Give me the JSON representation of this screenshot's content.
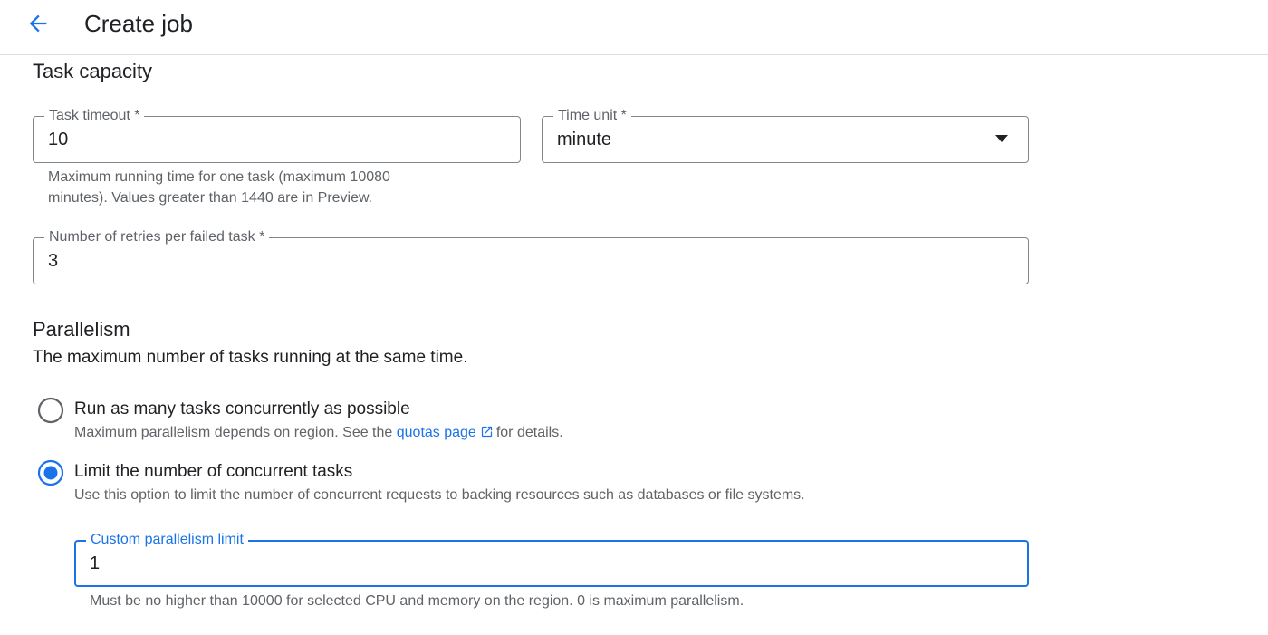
{
  "header": {
    "title": "Create job"
  },
  "task_capacity": {
    "title": "Task capacity",
    "task_timeout": {
      "label": "Task timeout *",
      "value": "10",
      "hint_line1": "Maximum running time for one task (maximum 10080",
      "hint_line2": "minutes). Values greater than 1440 are in Preview."
    },
    "time_unit": {
      "label": "Time unit *",
      "value": "minute"
    },
    "retries": {
      "label": "Number of retries per failed task *",
      "value": "3"
    }
  },
  "parallelism": {
    "title": "Parallelism",
    "description": "The maximum number of tasks running at the same time.",
    "option_unlimited": {
      "label": "Run as many tasks concurrently as possible",
      "desc_before": "Maximum parallelism depends on region. See the ",
      "link": "quotas page",
      "desc_after": "for details.",
      "selected": false
    },
    "option_limit": {
      "label": "Limit the number of concurrent tasks",
      "desc": "Use this option to limit the number of concurrent requests to backing resources such as databases or file systems.",
      "selected": true
    },
    "custom_limit": {
      "label": "Custom parallelism limit",
      "value": "1",
      "hint": "Must be no higher than 10000 for selected CPU and memory on the region. 0 is maximum parallelism."
    }
  },
  "colors": {
    "accent": "#1a73e8",
    "text": "#202124",
    "secondary": "#5f6368",
    "border": "#80868b"
  },
  "icons": {
    "back": "arrow-left-icon",
    "dropdown": "caret-down-icon",
    "external": "open-in-new-icon"
  }
}
